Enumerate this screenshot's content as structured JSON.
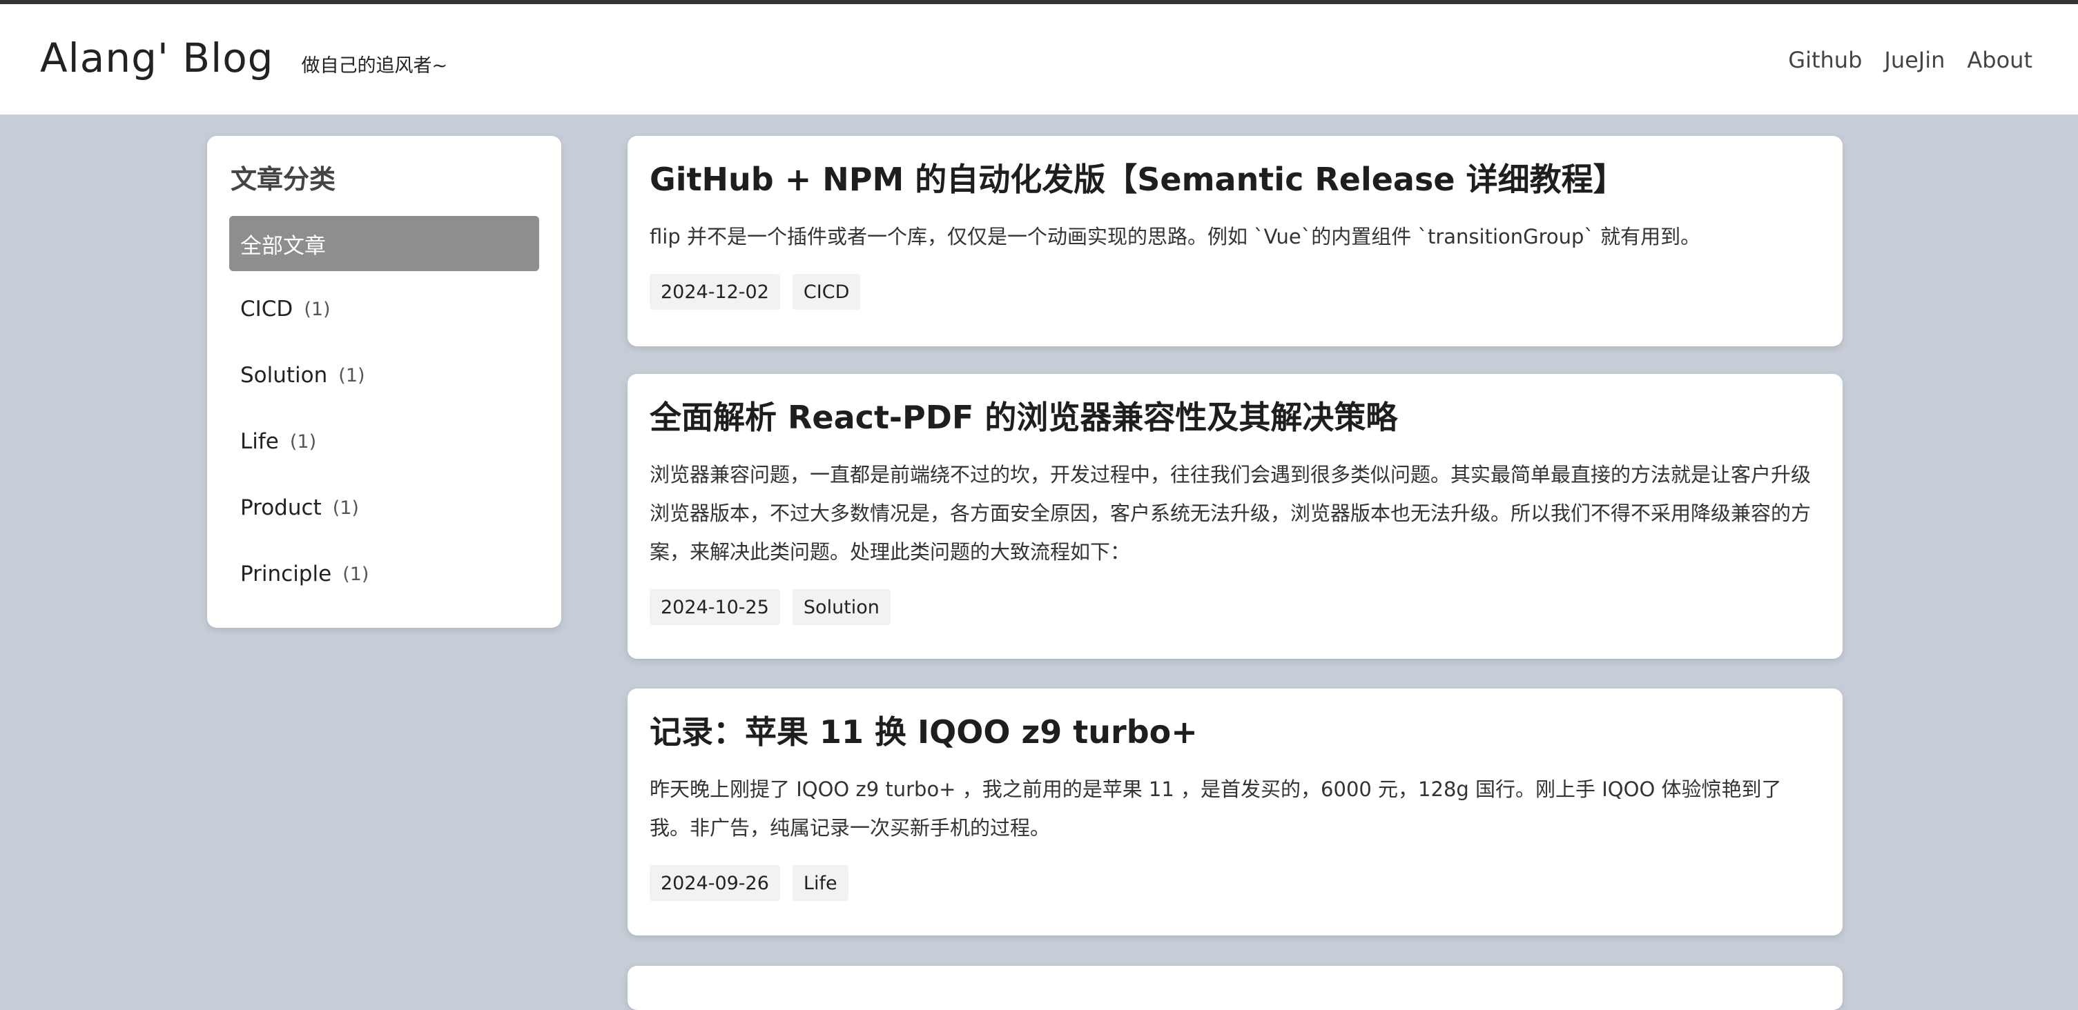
{
  "header": {
    "title": "Alang' Blog",
    "subtitle": "做自己的追风者~",
    "nav": [
      "Github",
      "JueJin",
      "About"
    ]
  },
  "sidebar": {
    "title": "文章分类",
    "items": [
      {
        "label": "全部文章",
        "count": ""
      },
      {
        "label": "CICD",
        "count": "(1)"
      },
      {
        "label": "Solution",
        "count": "(1)"
      },
      {
        "label": "Life",
        "count": "(1)"
      },
      {
        "label": "Product",
        "count": "(1)"
      },
      {
        "label": "Principle",
        "count": "(1)"
      }
    ]
  },
  "posts": [
    {
      "title": "GitHub + NPM 的自动化发版【Semantic Release 详细教程】",
      "desc": "flip 并不是一个插件或者一个库，仅仅是一个动画实现的思路。例如 `Vue`的内置组件 `transitionGroup` 就有用到。",
      "date": "2024-12-02",
      "category": "CICD"
    },
    {
      "title": "全面解析 React-PDF 的浏览器兼容性及其解决策略",
      "desc": "浏览器兼容问题，一直都是前端绕不过的坎，开发过程中，往往我们会遇到很多类似问题。其实最简单最直接的方法就是让客户升级浏览器版本，不过大多数情况是，各方面安全原因，客户系统无法升级，浏览器版本也无法升级。所以我们不得不采用降级兼容的方案，来解决此类问题。处理此类问题的大致流程如下：",
      "date": "2024-10-25",
      "category": "Solution"
    },
    {
      "title": "记录：苹果 11 换 IQOO z9 turbo+",
      "desc": "昨天晚上刚提了 IQOO z9 turbo+ ，我之前用的是苹果 11 ，是首发买的，6000 元，128g 国行。刚上手 IQOO 体验惊艳到了我。非广告，纯属记录一次买新手机的过程。",
      "date": "2024-09-26",
      "category": "Life"
    }
  ]
}
